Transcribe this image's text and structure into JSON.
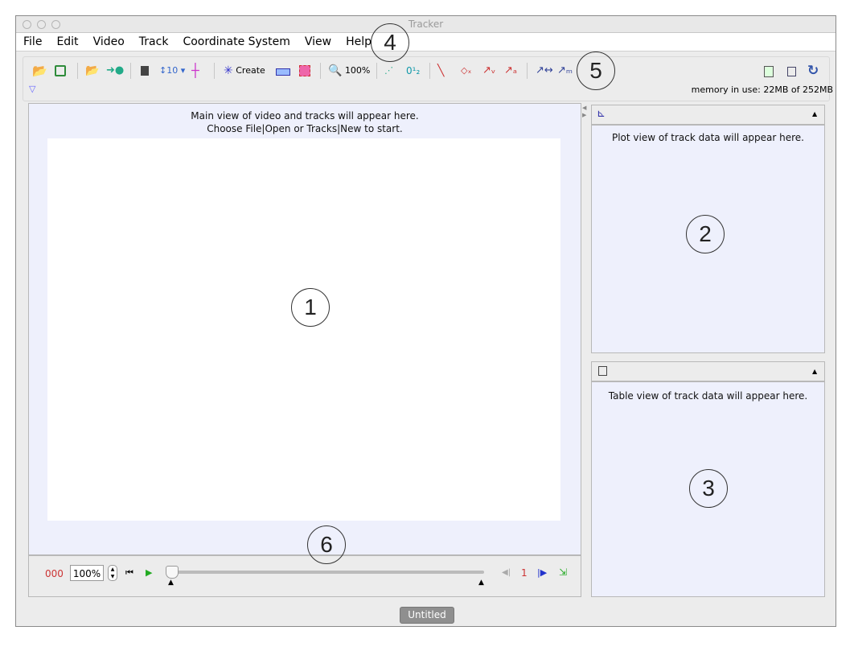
{
  "window": {
    "title": "Tracker"
  },
  "menu": [
    "File",
    "Edit",
    "Video",
    "Track",
    "Coordinate System",
    "View",
    "Help"
  ],
  "toolbar": {
    "create_label": "Create",
    "zoom_label": "100%",
    "memory": "memory in use: 22MB of 252MB",
    "icons": [
      "open-folder-icon",
      "save-icon",
      "open-import-icon",
      "export-icon",
      "clip-settings-icon",
      "calibration-tool-icon",
      "axes-icon",
      "create-track-icon",
      "ruler-icon",
      "data-track-icon",
      "zoom-icon",
      "trail-icon",
      "label-icon",
      "path-icon",
      "position-icon",
      "velocity-icon",
      "acceleration-icon",
      "stretch-vector-icon",
      "mass-vector-icon",
      "notes-icon",
      "properties-icon",
      "refresh-icon"
    ]
  },
  "main_view": {
    "line1": "Main view of video and tracks will appear here.",
    "line2": "Choose File|Open or Tracks|New to start."
  },
  "plot_view": {
    "message": "Plot view of track data will appear here."
  },
  "table_view": {
    "message": "Table view of track data will appear here."
  },
  "player": {
    "frame": "000",
    "rate": "100%",
    "step": "1",
    "slider_position": 0
  },
  "tab": {
    "label": "Untitled"
  },
  "annotations": [
    "1",
    "2",
    "3",
    "4",
    "5",
    "6"
  ]
}
